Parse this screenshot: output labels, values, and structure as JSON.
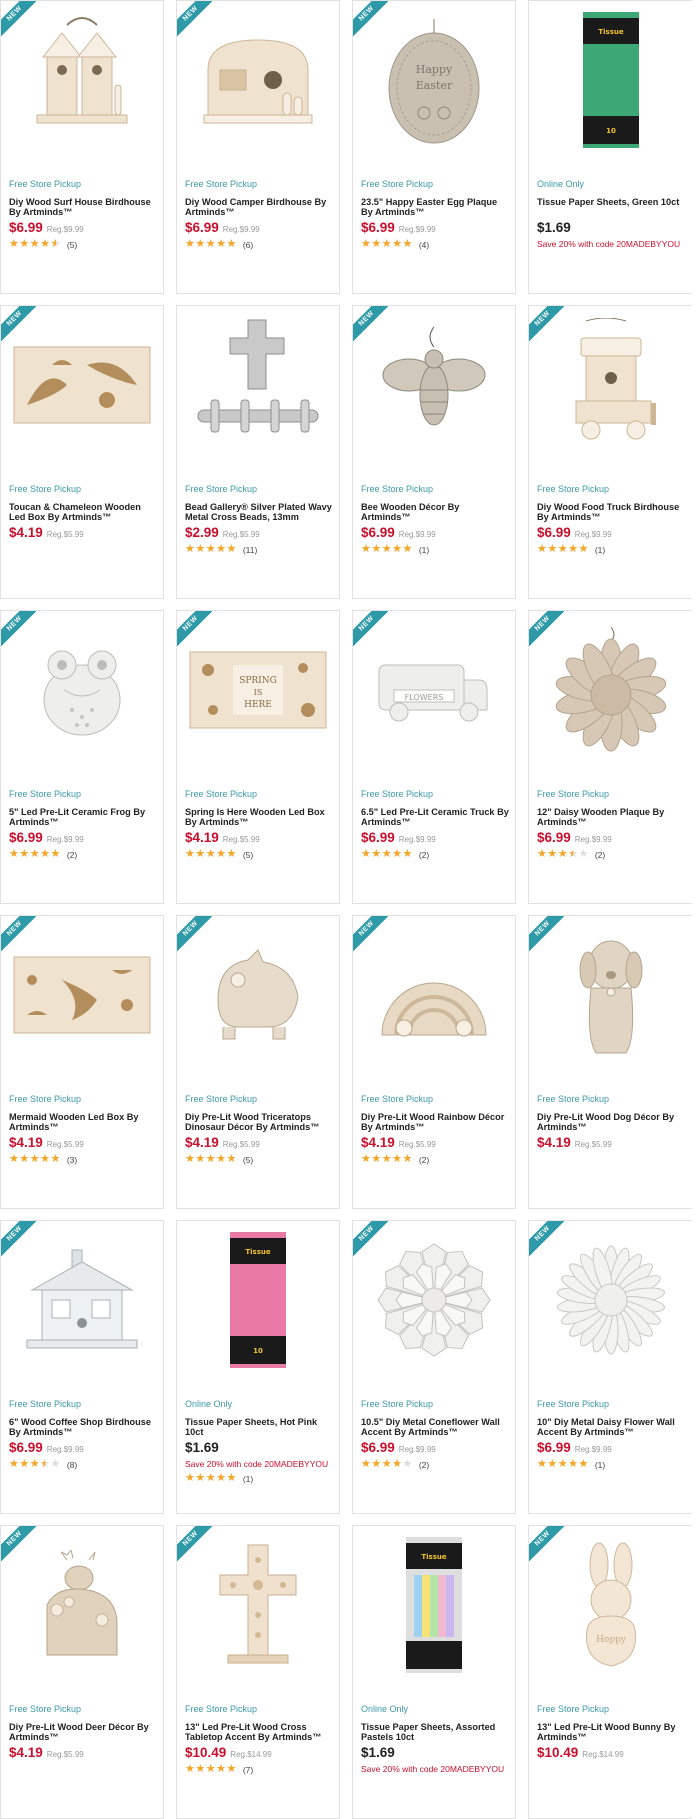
{
  "colors": {
    "accent": "#2e9aa7",
    "pickup": "#3d9aa9",
    "price": "#c8102e",
    "star": "#f5a623"
  },
  "ribbon_label": "NEW",
  "products": [
    {
      "img": "birdhouse",
      "is_new": true,
      "pickup": "Free Store Pickup",
      "title": "Diy Wood Surf House Birdhouse By Artminds™",
      "price": "$6.99",
      "reg": "Reg.$9.99",
      "rating": 0.9,
      "count": "(5)"
    },
    {
      "img": "camper",
      "is_new": true,
      "pickup": "Free Store Pickup",
      "title": "Diy Wood Camper Birdhouse By Artminds™",
      "price": "$6.99",
      "reg": "Reg.$9.99",
      "rating": 1.0,
      "count": "(6)"
    },
    {
      "img": "egg",
      "is_new": true,
      "pickup": "Free Store Pickup",
      "title": "23.5\" Happy Easter Egg Plaque By Artminds™",
      "price": "$6.99",
      "reg": "Reg.$9.99",
      "rating": 1.0,
      "count": "(4)"
    },
    {
      "img": "tissue-green",
      "is_new": false,
      "pickup": "Online Only",
      "title": "Tissue Paper Sheets, Green 10ct",
      "price": "$1.69",
      "promo": "Save 20% with code 20MADEBYYOU"
    },
    {
      "img": "ledbox",
      "is_new": true,
      "pickup": "Free Store Pickup",
      "title": "Toucan & Chameleon Wooden Led Box By Artminds™",
      "price": "$4.19",
      "reg": "Reg.$5.99"
    },
    {
      "img": "cross-beads",
      "is_new": false,
      "pickup": "Free Store Pickup",
      "title": "Bead Gallery® Silver Plated Wavy Metal Cross Beads, 13mm",
      "price": "$2.99",
      "reg": "Reg.$5.99",
      "rating": 1.0,
      "count": "(11)"
    },
    {
      "img": "bee",
      "is_new": true,
      "pickup": "Free Store Pickup",
      "title": "Bee Wooden Décor By Artminds™",
      "price": "$6.99",
      "reg": "Reg.$9.99",
      "rating": 1.0,
      "count": "(1)"
    },
    {
      "img": "foodtruck",
      "is_new": true,
      "pickup": "Free Store Pickup",
      "title": "Diy Wood Food Truck Birdhouse By Artminds™",
      "price": "$6.99",
      "reg": "Reg.$9.99",
      "rating": 1.0,
      "count": "(1)"
    },
    {
      "img": "frog",
      "is_new": true,
      "pickup": "Free Store Pickup",
      "title": "5\" Led Pre-Lit Ceramic Frog By Artminds™",
      "price": "$6.99",
      "reg": "Reg.$9.99",
      "rating": 1.0,
      "count": "(2)"
    },
    {
      "img": "spring-box",
      "is_new": true,
      "pickup": "Free Store Pickup",
      "title": "Spring Is Here Wooden Led Box By Artminds™",
      "price": "$4.19",
      "reg": "Reg.$5.99",
      "rating": 1.0,
      "count": "(5)"
    },
    {
      "img": "truck",
      "is_new": true,
      "pickup": "Free Store Pickup",
      "title": "6.5\" Led Pre-Lit Ceramic Truck By Artminds™",
      "price": "$6.99",
      "reg": "Reg.$9.99",
      "rating": 1.0,
      "count": "(2)"
    },
    {
      "img": "daisy-plaque",
      "is_new": true,
      "pickup": "Free Store Pickup",
      "title": "12\" Daisy Wooden Plaque By Artminds™",
      "price": "$6.99",
      "reg": "Reg.$9.99",
      "rating": 0.7,
      "count": "(2)"
    },
    {
      "img": "mermaid-box",
      "is_new": true,
      "pickup": "Free Store Pickup",
      "title": "Mermaid Wooden Led Box By Artminds™",
      "price": "$4.19",
      "reg": "Reg.$5.99",
      "rating": 1.0,
      "count": "(3)"
    },
    {
      "img": "triceratops",
      "is_new": true,
      "pickup": "Free Store Pickup",
      "title": "Diy Pre-Lit Wood Triceratops Dinosaur Décor By Artminds™",
      "price": "$4.19",
      "reg": "Reg.$5.99",
      "rating": 1.0,
      "count": "(5)"
    },
    {
      "img": "rainbow",
      "is_new": true,
      "pickup": "Free Store Pickup",
      "title": "Diy Pre-Lit Wood Rainbow Décor By Artminds™",
      "price": "$4.19",
      "reg": "Reg.$5.99",
      "rating": 1.0,
      "count": "(2)"
    },
    {
      "img": "dog",
      "is_new": true,
      "pickup": "Free Store Pickup",
      "title": "Diy Pre-Lit Wood Dog Décor By Artminds™",
      "price": "$4.19",
      "reg": "Reg.$5.99"
    },
    {
      "img": "coffee-shop",
      "is_new": true,
      "pickup": "Free Store Pickup",
      "title": "6\" Wood Coffee Shop Birdhouse By Artminds™",
      "price": "$6.99",
      "reg": "Reg.$9.99",
      "rating": 0.7,
      "count": "(8)"
    },
    {
      "img": "tissue-pink",
      "is_new": false,
      "pickup": "Online Only",
      "title": "Tissue Paper Sheets, Hot Pink 10ct",
      "price": "$1.69",
      "promo": "Save 20% with code 20MADEBYYOU",
      "rating": 1.0,
      "count": "(1)"
    },
    {
      "img": "coneflower",
      "is_new": true,
      "pickup": "Free Store Pickup",
      "title": "10.5\" Diy Metal Coneflower Wall Accent By Artminds™",
      "price": "$6.99",
      "reg": "Reg.$9.99",
      "rating": 0.8,
      "count": "(2)"
    },
    {
      "img": "daisy-metal",
      "is_new": true,
      "pickup": "Free Store Pickup",
      "title": "10\" Diy Metal Daisy Flower Wall Accent By Artminds™",
      "price": "$6.99",
      "reg": "Reg.$9.99",
      "rating": 1.0,
      "count": "(1)"
    },
    {
      "img": "deer",
      "is_new": true,
      "pickup": "Free Store Pickup",
      "title": "Diy Pre-Lit Wood Deer Décor By Artminds™",
      "price": "$4.19",
      "reg": "Reg.$5.99"
    },
    {
      "img": "wood-cross",
      "is_new": true,
      "pickup": "Free Store Pickup",
      "title": "13\" Led Pre-Lit Wood Cross Tabletop Accent By Artminds™",
      "price": "$10.49",
      "reg": "Reg.$14.99",
      "rating": 1.0,
      "count": "(7)"
    },
    {
      "img": "tissue-pastel",
      "is_new": false,
      "pickup": "Online Only",
      "title": "Tissue Paper Sheets, Assorted Pastels 10ct",
      "price": "$1.69",
      "promo": "Save 20% with code 20MADEBYYOU"
    },
    {
      "img": "bunny",
      "is_new": true,
      "pickup": "Free Store Pickup",
      "title": "13\" Led Pre-Lit Wood Bunny By Artminds™",
      "price": "$10.49",
      "reg": "Reg.$14.99"
    }
  ]
}
